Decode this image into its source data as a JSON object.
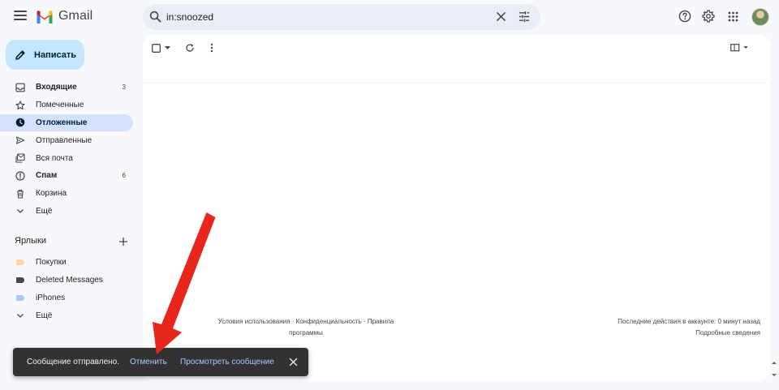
{
  "app": {
    "name": "Gmail"
  },
  "search": {
    "value": "in:snoozed"
  },
  "compose": {
    "label": "Написать"
  },
  "nav": {
    "items": [
      {
        "label": "Входящие",
        "count": "3"
      },
      {
        "label": "Помеченные",
        "count": ""
      },
      {
        "label": "Отложенные",
        "count": ""
      },
      {
        "label": "Отправленные",
        "count": ""
      },
      {
        "label": "Вся почта",
        "count": ""
      },
      {
        "label": "Спам",
        "count": "6"
      },
      {
        "label": "Корзина",
        "count": ""
      },
      {
        "label": "Ещё",
        "count": ""
      }
    ]
  },
  "labels": {
    "heading": "Ярлыки",
    "items": [
      {
        "label": "Покупки",
        "color": "#fdd7a7"
      },
      {
        "label": "Deleted Messages",
        "color": "#444746"
      },
      {
        "label": "iPhones",
        "color": "#a8c7fa"
      },
      {
        "label": "Ещё",
        "color": ""
      }
    ]
  },
  "footer": {
    "terms": "Условия использования · Конфиденциальность · Правила программы",
    "activity": "Последние действия в аккаунте: 0 минут назад",
    "details": "Подробные сведения"
  },
  "snackbar": {
    "message": "Сообщение отправлено.",
    "undo": "Отменить",
    "view": "Просмотреть сообщение"
  },
  "colors": {
    "accent_nav": "#d3e3fd",
    "compose_bg": "#c2e7ff",
    "annotation_arrow": "#e8261c"
  }
}
